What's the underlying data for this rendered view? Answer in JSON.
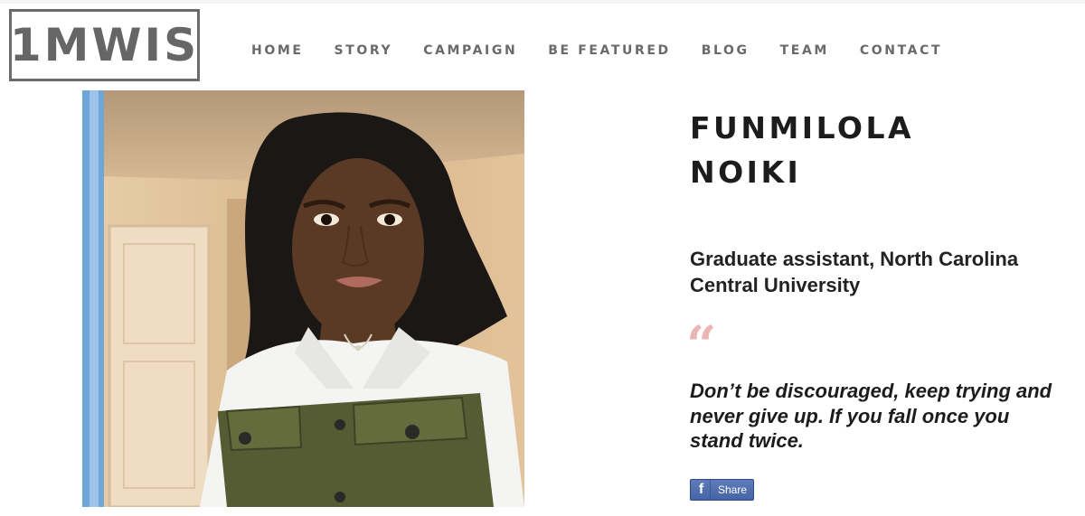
{
  "logo": {
    "text": "1MWIS"
  },
  "nav": {
    "items": [
      "HOME",
      "STORY",
      "CAMPAIGN",
      "BE FEATURED",
      "BLOG",
      "TEAM",
      "CONTACT"
    ]
  },
  "profile": {
    "name_line1": "FUNMILOLA",
    "name_line2": "NOIKI",
    "role_line1": "Graduate assistant, North Carolina",
    "role_line2": "Central University",
    "quote_mark": "“",
    "quote_line1": "Don’t be discouraged, keep trying and",
    "quote_line2": "never give up. If you fall once you",
    "quote_line3": "stand twice."
  },
  "share": {
    "icon": "facebook-icon",
    "label": "Share"
  },
  "colors": {
    "nav_text": "#6a6a6a",
    "heading": "#1c1c1c",
    "quote_mark": "#eab6b3",
    "facebook_blue": "#4565a6"
  }
}
